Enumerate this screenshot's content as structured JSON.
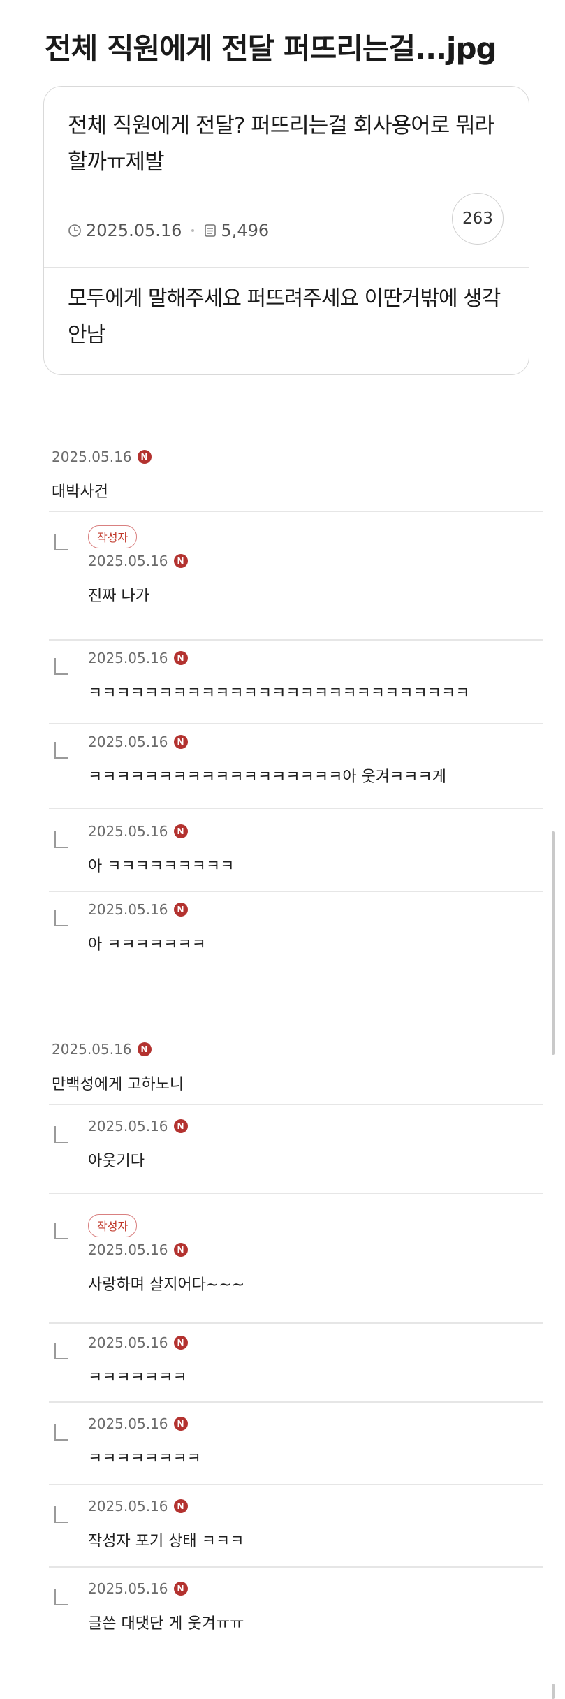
{
  "post": {
    "title": "전체 직원에게 전달 퍼뜨리는걸...jpg"
  },
  "card": {
    "title": "전체 직원에게 전달? 퍼뜨리는걸 회사용어로 뭐라할까ㅠ제발",
    "date": "2025.05.16",
    "views": "5,496",
    "comment_count": "263",
    "excerpt": "모두에게 말해주세요 퍼뜨려주세요 이딴거밖에 생각안남"
  },
  "icons": {
    "clock": "clock-icon",
    "document": "document-icon",
    "new": "new-badge-icon",
    "reply": "reply-arrow-icon"
  },
  "accent_color": "#b3322f",
  "new_label": "N",
  "author_badge": "작성자",
  "comments": [
    {
      "date": "2025.05.16",
      "text": "대박사건"
    },
    {
      "date": "2025.05.16",
      "text": "진짜 나가",
      "author": true
    },
    {
      "date": "2025.05.16",
      "text": "ㅋㅋㅋㅋㅋㅋㅋㅋㅋㅋㅋㅋㅋㅋㅋㅋㅋㅋㅋㅋㅋㅋㅋㅋㅋㅋㅋ"
    },
    {
      "date": "2025.05.16",
      "text": "ㅋㅋㅋㅋㅋㅋㅋㅋㅋㅋㅋㅋㅋㅋㅋㅋㅋㅋ아 웃겨ㅋㅋㅋ게"
    },
    {
      "date": "2025.05.16",
      "text": "아 ㅋㅋㅋㅋㅋㅋㅋㅋㅋ"
    },
    {
      "date": "2025.05.16",
      "text": "아 ㅋㅋㅋㅋㅋㅋㅋ"
    },
    {
      "date": "2025.05.16",
      "text": "만백성에게 고하노니"
    },
    {
      "date": "2025.05.16",
      "text": "아웃기다"
    },
    {
      "date": "2025.05.16",
      "text": "사랑하며 살지어다~~~",
      "author": true
    },
    {
      "date": "2025.05.16",
      "text": "ㅋㅋㅋㅋㅋㅋㅋ"
    },
    {
      "date": "2025.05.16",
      "text": "ㅋㅋㅋㅋㅋㅋㅋㅋ"
    },
    {
      "date": "2025.05.16",
      "text": "작성자 포기 상태 ㅋㅋㅋ"
    },
    {
      "date": "2025.05.16",
      "text": "글쓴 대댓단 게 웃겨ㅠㅠ"
    }
  ]
}
